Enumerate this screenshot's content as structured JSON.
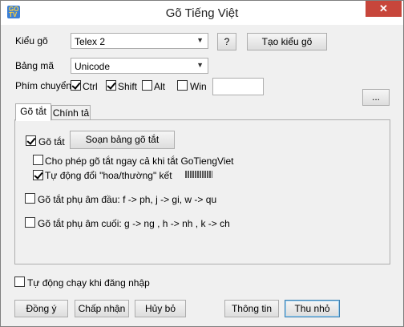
{
  "window": {
    "title": "Gõ Tiếng Việt",
    "close_glyph": "✕"
  },
  "top": {
    "kieu_go_label": "Kiểu gõ",
    "kieu_go_value": "Telex 2",
    "help_button": "?",
    "create_style_button": "Tạo kiểu gõ",
    "bang_ma_label": "Bảng mã",
    "bang_ma_value": "Unicode",
    "phim_chuyen_label": "Phím chuyển",
    "modifiers": [
      {
        "label": "Ctrl",
        "checked": true
      },
      {
        "label": "Shift",
        "checked": true
      },
      {
        "label": "Alt",
        "checked": false
      },
      {
        "label": "Win",
        "checked": false
      }
    ],
    "hotkey_value": "",
    "more_button": "..."
  },
  "tabs": [
    {
      "label": "Gõ tắt",
      "active": true
    },
    {
      "label": "Chính tả",
      "active": false
    }
  ],
  "shortcut_panel": {
    "go_tat_label": "Gõ tắt",
    "go_tat_checked": true,
    "edit_table_button": "Soạn bảng gõ tắt",
    "allow_always_label": "Cho phép gõ tắt ngay cả khi tắt GoTiengViet",
    "allow_always_checked": false,
    "auto_case_label": "Tự động đổi \"hoa/thường\" kết",
    "auto_case_checked": true,
    "initial_consonant_label": "Gõ tắt phụ âm đầu: f -> ph, j -> gi, w -> qu",
    "initial_consonant_checked": false,
    "final_consonant_label": "Gõ tắt phụ âm cuối: g -> ng , h -> nh , k -> ch",
    "final_consonant_checked": false
  },
  "autostart": {
    "label": "Tự động chạy khi đăng nhập",
    "checked": false
  },
  "buttons": {
    "ok": "Đồng ý",
    "apply": "Chấp nhận",
    "cancel": "Hủy bỏ",
    "info": "Thông tin",
    "minimize": "Thu nhỏ"
  },
  "colors": {
    "accent": "#3c7fb1",
    "close": "#c7463b"
  },
  "icons": {
    "app": "app-logo-icon",
    "dropdown": "chevron-down-icon",
    "check": "checkmark-icon"
  }
}
